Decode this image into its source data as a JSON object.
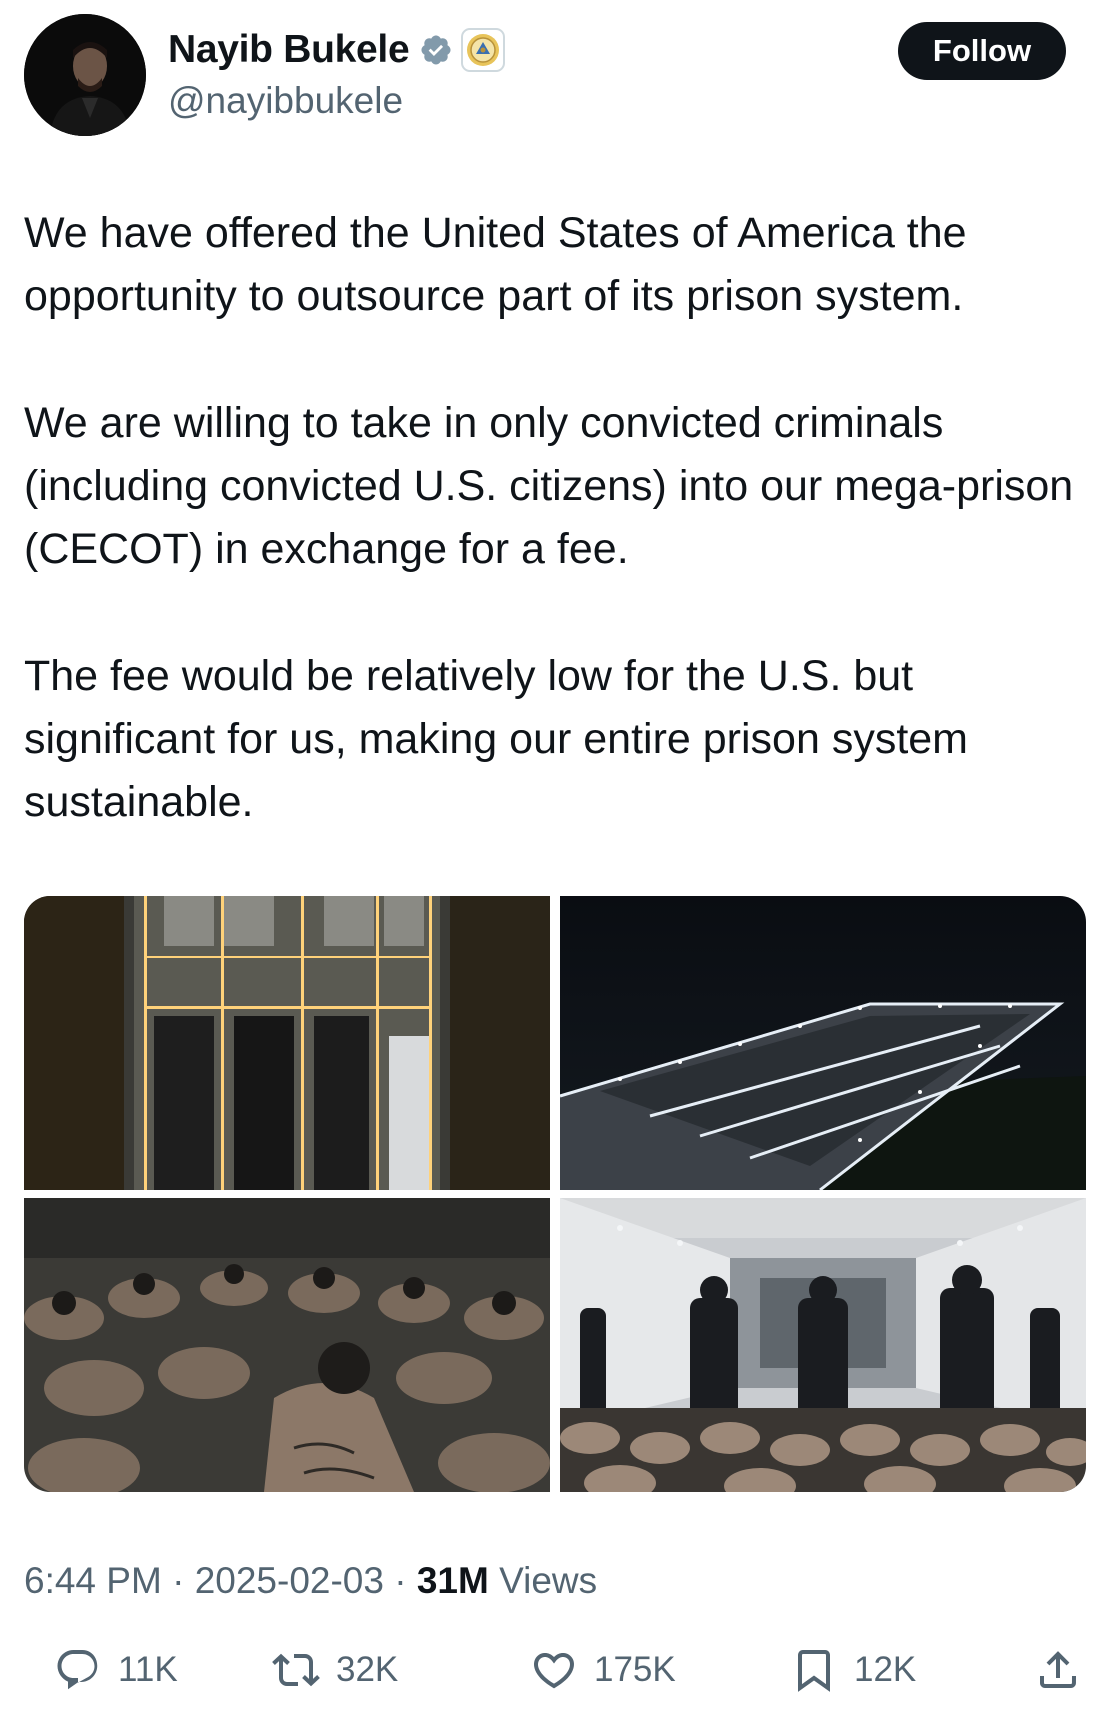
{
  "author": {
    "display_name": "Nayib Bukele",
    "handle": "@nayibbukele",
    "verified": true,
    "affiliation_badge": "el-salvador-coat-of-arms-icon"
  },
  "follow_button": {
    "label": "Follow"
  },
  "tweet": {
    "paragraphs": [
      "We have offered the United States of America the opportunity to outsource part of its prison system.",
      "We are willing to take in only convicted criminals (including convicted U.S. citizens) into our mega-prison (CECOT) in exchange for a fee.",
      "The fee would be relatively low for the U.S. but significant for us, making our entire prison system sustainable."
    ]
  },
  "media": [
    {
      "name": "prison-aerial-top-down-photo"
    },
    {
      "name": "prison-aerial-night-photo"
    },
    {
      "name": "inmates-seated-photo"
    },
    {
      "name": "guards-hall-photo"
    }
  ],
  "meta": {
    "time": "6:44 PM",
    "separator": "·",
    "date": "2025-02-03",
    "views_count": "31M",
    "views_label": "Views"
  },
  "actions": {
    "reply": {
      "icon": "reply-icon",
      "count": "11K"
    },
    "repost": {
      "icon": "repost-icon",
      "count": "32K"
    },
    "like": {
      "icon": "heart-icon",
      "count": "175K"
    },
    "bookmark": {
      "icon": "bookmark-icon",
      "count": "12K"
    },
    "share": {
      "icon": "share-icon"
    }
  },
  "colors": {
    "text": "#0f1419",
    "secondary": "#536471",
    "verified": "#829aab",
    "follow_bg": "#0f1419"
  }
}
